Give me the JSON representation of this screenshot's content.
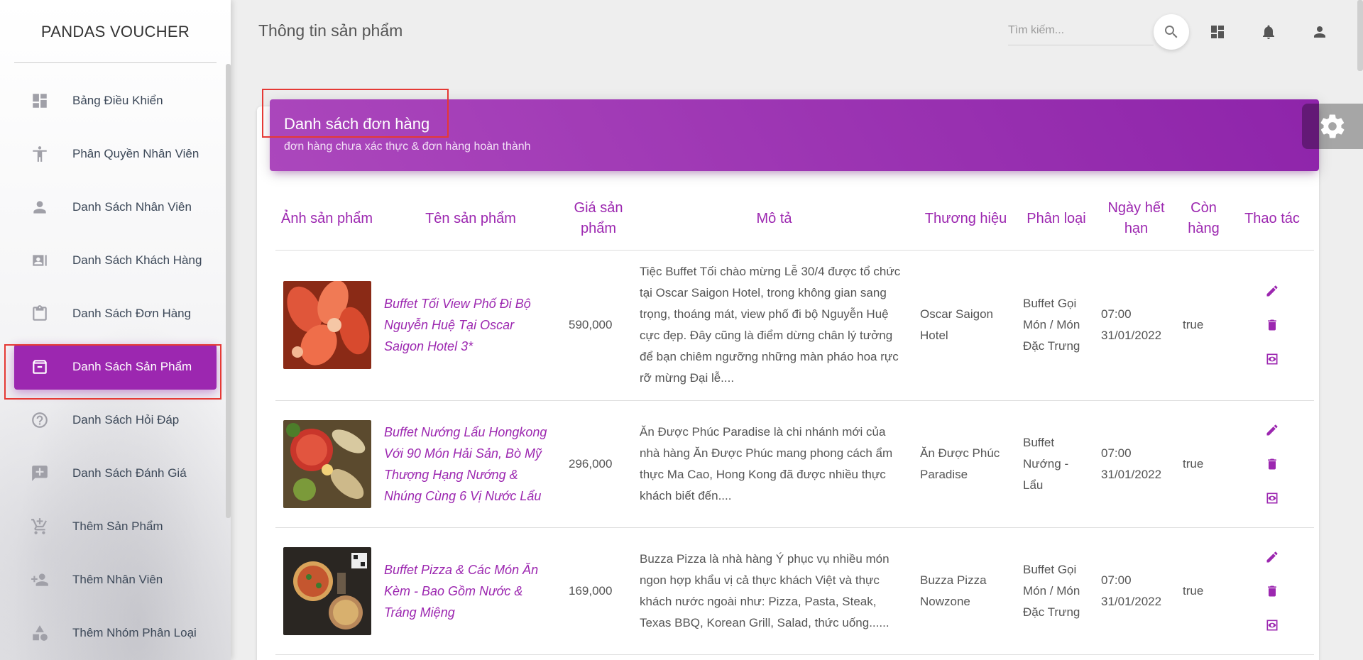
{
  "sidebar": {
    "brand": "PANDAS VOUCHER",
    "items": [
      {
        "label": "Bảng Điều Khiển",
        "icon": "dashboard-icon"
      },
      {
        "label": "Phân Quyền Nhân Viên",
        "icon": "accessibility-icon"
      },
      {
        "label": "Danh Sách Nhân Viên",
        "icon": "person-icon"
      },
      {
        "label": "Danh Sách Khách Hàng",
        "icon": "contact-card-icon"
      },
      {
        "label": "Danh Sách Đơn Hàng",
        "icon": "clipboard-icon"
      },
      {
        "label": "Danh Sách Sản Phẩm",
        "icon": "archive-icon",
        "active": true
      },
      {
        "label": "Danh Sách Hỏi Đáp",
        "icon": "help-circle-icon"
      },
      {
        "label": "Danh Sách Đánh Giá",
        "icon": "rate-review-icon"
      },
      {
        "label": "Thêm Sản Phẩm",
        "icon": "add-cart-icon"
      },
      {
        "label": "Thêm Nhân Viên",
        "icon": "person-add-icon"
      },
      {
        "label": "Thêm Nhóm Phân Loại",
        "icon": "category-icon"
      }
    ]
  },
  "header": {
    "title": "Thông tin sản phẩm",
    "search_placeholder": "Tìm kiếm...",
    "icons": [
      "search-icon",
      "dashboard-icon",
      "bell-icon",
      "account-icon"
    ]
  },
  "card": {
    "title": "Danh sách đơn hàng",
    "subtitle": "đơn hàng chưa xác thực & đơn hàng hoàn thành"
  },
  "table": {
    "columns": [
      "Ảnh sản phẩm",
      "Tên sản phẩm",
      "Giá sản phẩm",
      "Mô tả",
      "Thương hiệu",
      "Phân loại",
      "Ngày hết hạn",
      "Còn hàng",
      "Thao tác"
    ],
    "rows": [
      {
        "name": "Buffet Tối View Phố Đi Bộ Nguyễn Huệ Tại Oscar Saigon Hotel 3*",
        "price": "590,000",
        "description": "Tiệc Buffet Tối chào mừng Lễ 30/4 được tổ chức tại Oscar Saigon Hotel, trong không gian sang trọng, thoáng mát, view phố đi bộ Nguyễn Huệ cực đẹp. Đây cũng là điểm dừng chân lý tưởng để bạn chiêm ngưỡng những màn pháo hoa rực rỡ mừng Đại lễ....",
        "brand": "Oscar Saigon Hotel",
        "category": "Buffet Gọi Món / Món Đặc Trưng",
        "expiry": "07:00 31/01/2022",
        "in_stock": "true"
      },
      {
        "name": "Buffet Nướng Lẩu Hongkong Với 90 Món Hải Sản, Bò Mỹ Thượng Hạng Nướng & Nhúng Cùng 6 Vị Nước Lẩu",
        "price": "296,000",
        "description": "Ăn Được Phúc Paradise là chi nhánh mới của nhà hàng Ăn Được Phúc mang phong cách ẩm thực Ma Cao, Hong Kong đã được nhiều thực khách biết đến....",
        "brand": "Ăn Được Phúc Paradise",
        "category": "Buffet Nướng - Lẩu",
        "expiry": "07:00 31/01/2022",
        "in_stock": "true"
      },
      {
        "name": "Buffet Pizza & Các Món Ăn Kèm - Bao Gồm Nước & Tráng Miệng",
        "price": "169,000",
        "description": "Buzza Pizza là nhà hàng Ý phục vụ nhiều món ngon hợp khẩu vị cả thực khách Việt và thực khách nước ngoài như: Pizza, Pasta, Steak, Texas BBQ, Korean Grill, Salad, thức uống......",
        "brand": "Buzza Pizza Nowzone",
        "category": "Buffet Gọi Món / Món Đặc Trưng",
        "expiry": "07:00 31/01/2022",
        "in_stock": "true"
      }
    ]
  },
  "colors": {
    "accent": "#9c27b0",
    "highlight": "#e53935"
  }
}
